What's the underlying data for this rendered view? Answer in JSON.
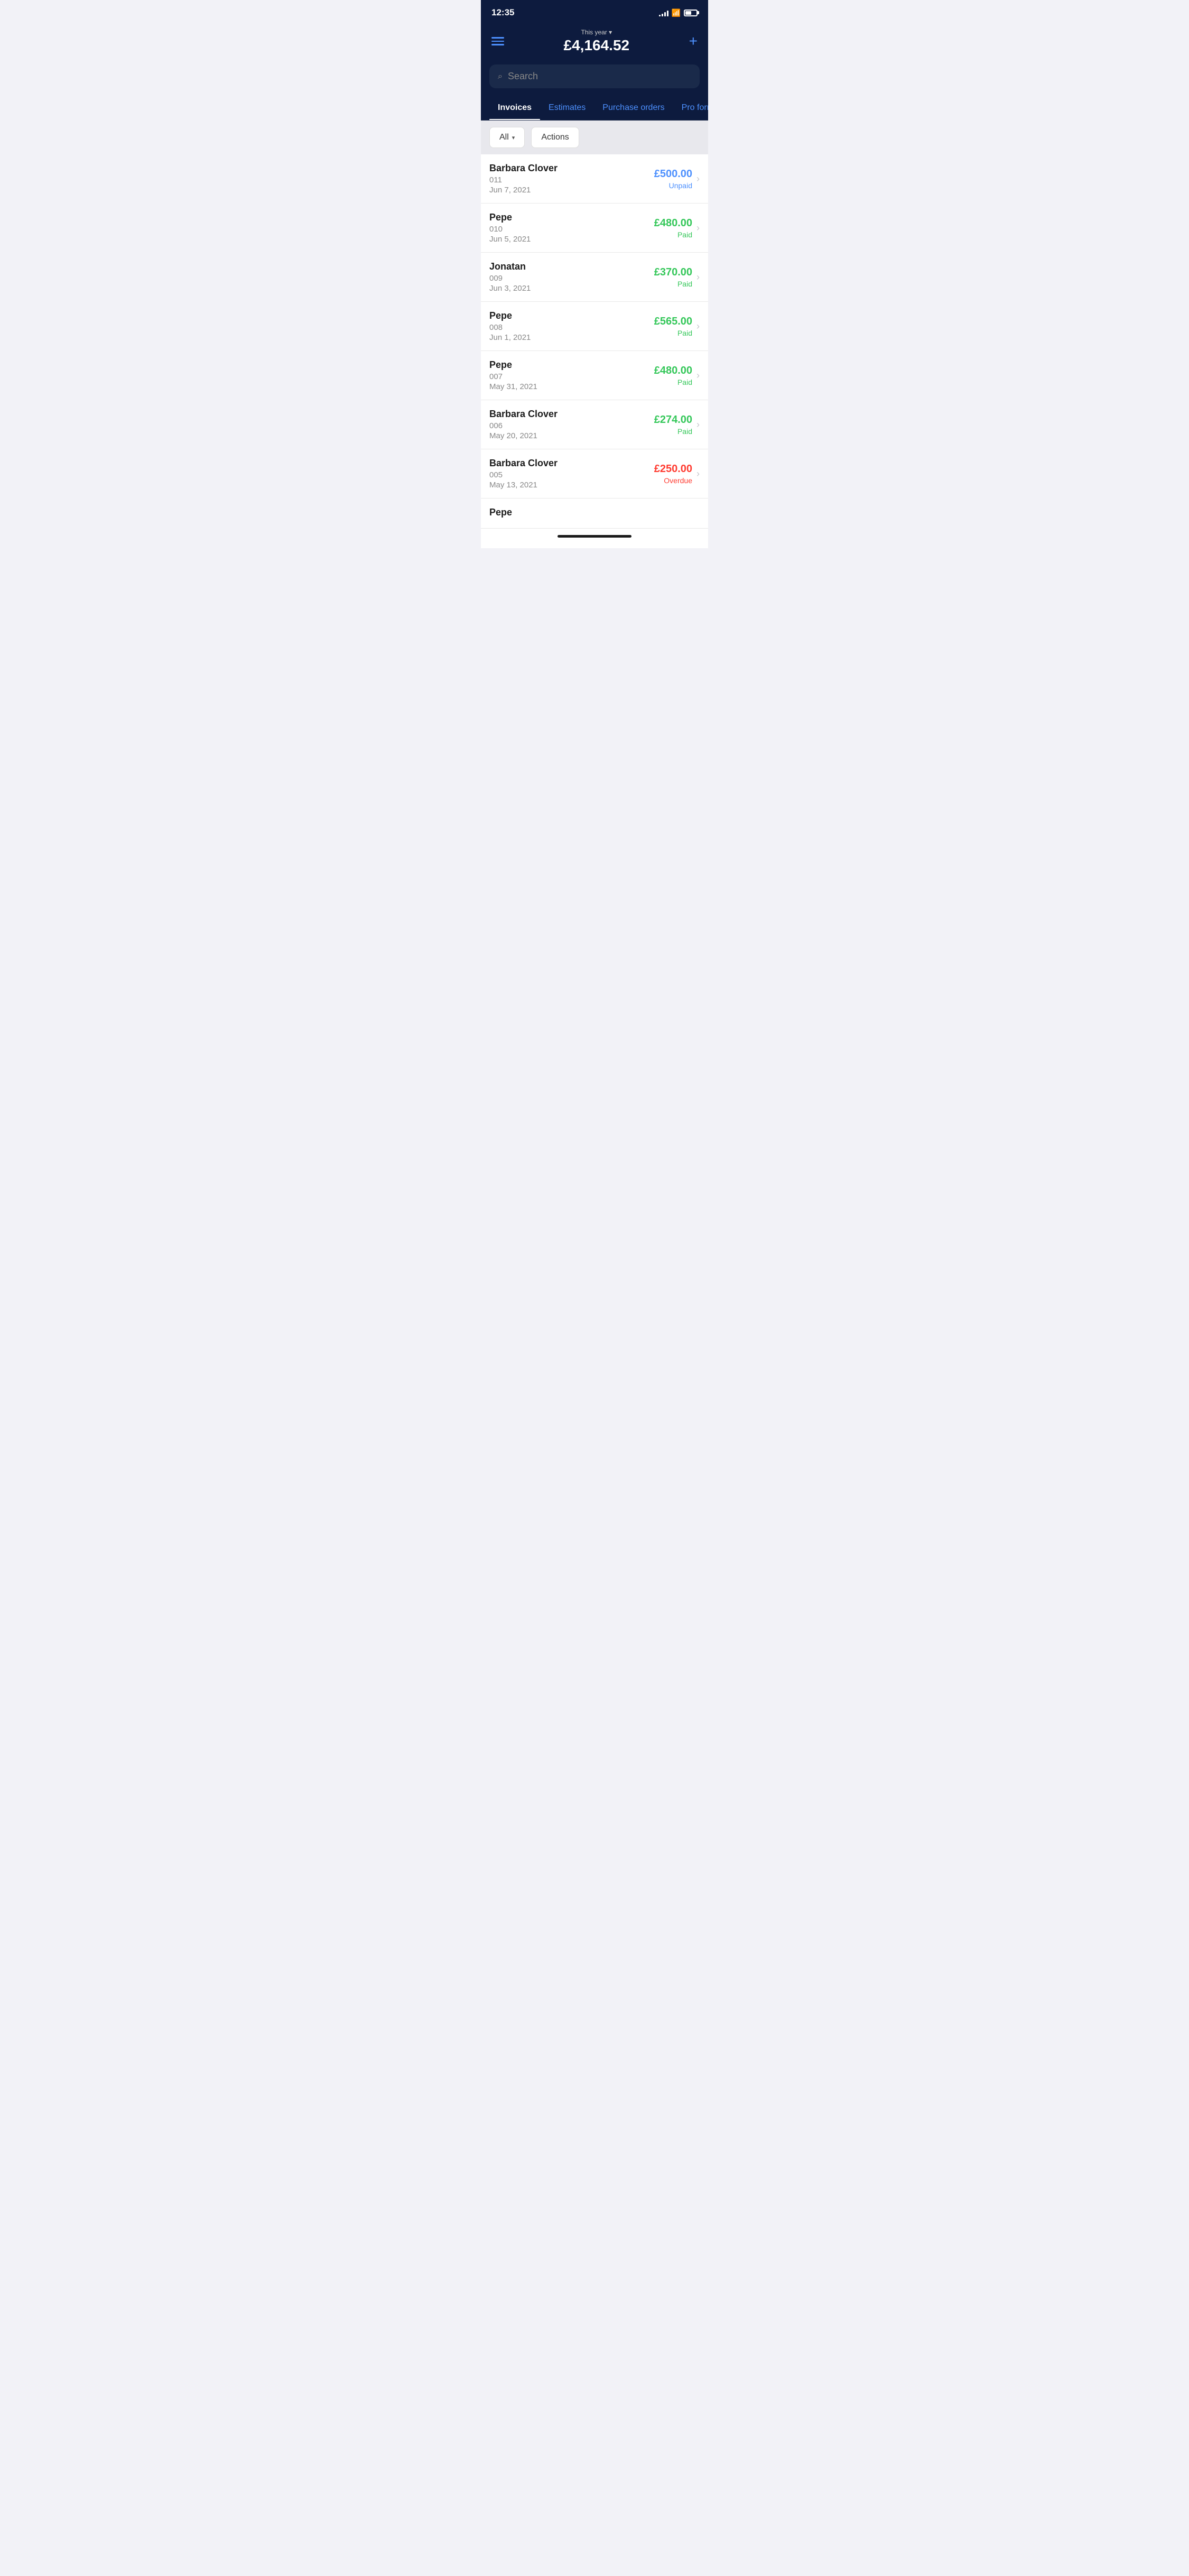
{
  "statusBar": {
    "time": "12:35",
    "signal": [
      3,
      5,
      8,
      11,
      14
    ],
    "battery": 55
  },
  "header": {
    "period": "This year ▾",
    "amount": "£4,164.52",
    "menuLabel": "Menu",
    "addLabel": "Add"
  },
  "search": {
    "placeholder": "Search"
  },
  "tabs": [
    {
      "label": "Invoices",
      "active": true
    },
    {
      "label": "Estimates",
      "active": false
    },
    {
      "label": "Purchase orders",
      "active": false
    },
    {
      "label": "Pro forma",
      "active": false
    }
  ],
  "filters": {
    "allLabel": "All",
    "actionsLabel": "Actions"
  },
  "invoices": [
    {
      "name": "Barbara Clover",
      "number": "011",
      "date": "Jun 7, 2021",
      "amount": "£500.00",
      "status": "Unpaid",
      "statusType": "unpaid"
    },
    {
      "name": "Pepe",
      "number": "010",
      "date": "Jun 5, 2021",
      "amount": "£480.00",
      "status": "Paid",
      "statusType": "paid"
    },
    {
      "name": "Jonatan",
      "number": "009",
      "date": "Jun 3, 2021",
      "amount": "£370.00",
      "status": "Paid",
      "statusType": "paid"
    },
    {
      "name": "Pepe",
      "number": "008",
      "date": "Jun 1, 2021",
      "amount": "£565.00",
      "status": "Paid",
      "statusType": "paid"
    },
    {
      "name": "Pepe",
      "number": "007",
      "date": "May 31, 2021",
      "amount": "£480.00",
      "status": "Paid",
      "statusType": "paid"
    },
    {
      "name": "Barbara Clover",
      "number": "006",
      "date": "May 20, 2021",
      "amount": "£274.00",
      "status": "Paid",
      "statusType": "paid"
    },
    {
      "name": "Barbara Clover",
      "number": "005",
      "date": "May 13, 2021",
      "amount": "£250.00",
      "status": "Overdue",
      "statusType": "overdue"
    },
    {
      "name": "Pepe",
      "number": "",
      "date": "",
      "amount": "",
      "status": "",
      "statusType": ""
    }
  ]
}
